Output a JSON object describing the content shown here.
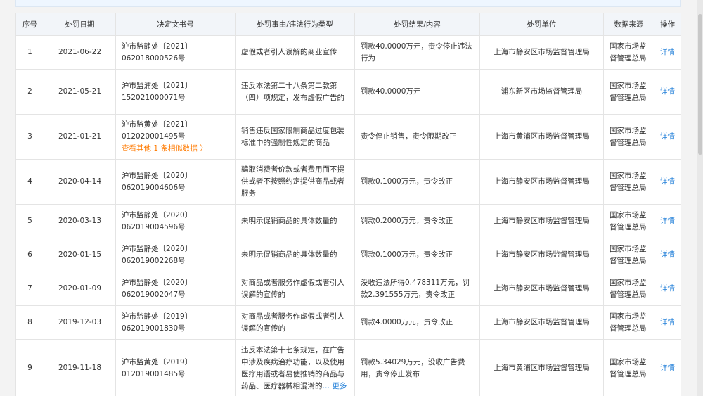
{
  "table": {
    "headers": [
      "序号",
      "处罚日期",
      "决定文书号",
      "处罚事由/违法行为类型",
      "处罚结果/内容",
      "处罚单位",
      "数据来源",
      "操作"
    ],
    "rows": [
      {
        "no": "1",
        "date": "2021-06-22",
        "doc": "沪市监静处〔2021〕062018000526号",
        "reason": "虚假或者引人误解的商业宣传",
        "result": "罚款40.0000万元，责令停止违法行为",
        "unit": "上海市静安区市场监督管理局",
        "source": "国家市场监督管理总局",
        "action": "详情"
      },
      {
        "no": "2",
        "date": "2021-05-21",
        "doc": "沪市监浦处〔2021〕152021000071号",
        "reason": "违反本法第二十八条第二款第（四）项规定，发布虚假广告的",
        "result": "罚款40.0000万元",
        "unit": "浦东新区市场监督管理局",
        "source": "国家市场监督管理总局",
        "action": "详情"
      },
      {
        "no": "3",
        "date": "2021-01-21",
        "doc": "沪市监黄处〔2021〕012020001495号",
        "similar": "查看其他 1 条相似数据 〉",
        "reason": "销售违反国家限制商品过度包装标准中的强制性规定的商品",
        "result": "责令停止销售，责令限期改正",
        "unit": "上海市黄浦区市场监督管理局",
        "source": "国家市场监督管理总局",
        "action": "详情"
      },
      {
        "no": "4",
        "date": "2020-04-14",
        "doc": "沪市监静处〔2020〕062019004606号",
        "reason": "骗取消费者价款或者费用而不提供或者不按照约定提供商品或者服务",
        "result": "罚款0.1000万元，责令改正",
        "unit": "上海市静安区市场监督管理局",
        "source": "国家市场监督管理总局",
        "action": "详情"
      },
      {
        "no": "5",
        "date": "2020-03-13",
        "doc": "沪市监静处〔2020〕062019004596号",
        "reason": "未明示促销商品的具体数量的",
        "result": "罚款0.2000万元，责令改正",
        "unit": "上海市静安区市场监督管理局",
        "source": "国家市场监督管理总局",
        "action": "详情"
      },
      {
        "no": "6",
        "date": "2020-01-15",
        "doc": "沪市监静处〔2020〕062019002268号",
        "reason": "未明示促销商品的具体数量的",
        "result": "罚款0.1000万元，责令改正",
        "unit": "上海市静安区市场监督管理局",
        "source": "国家市场监督管理总局",
        "action": "详情"
      },
      {
        "no": "7",
        "date": "2020-01-09",
        "doc": "沪市监静处〔2020〕062019002047号",
        "reason": "对商品或者服务作虚假或者引人误解的宣传的",
        "result": "没收违法所得0.478311万元，罚款2.391555万元，责令改正",
        "unit": "上海市静安区市场监督管理局",
        "source": "国家市场监督管理总局",
        "action": "详情"
      },
      {
        "no": "8",
        "date": "2019-12-03",
        "doc": "沪市监静处〔2019〕062019001830号",
        "reason": "对商品或者服务作虚假或者引人误解的宣传的",
        "result": "罚款4.0000万元，责令改正",
        "unit": "上海市静安区市场监督管理局",
        "source": "国家市场监督管理总局",
        "action": "详情"
      },
      {
        "no": "9",
        "date": "2019-11-18",
        "doc": "沪市监黄处〔2019〕012019001485号",
        "reason": "违反本法第十七条规定，在广告中涉及疾病治疗功能，以及使用医疗用语或者易使推销的商品与药品、医疗器械相混淆的",
        "more": "… 更多",
        "result": "罚款5.34029万元，没收广告费用，责令停止发布",
        "unit": "上海市黄浦区市场监督管理局",
        "source": "国家市场监督管理总局",
        "action": "详情"
      }
    ]
  }
}
